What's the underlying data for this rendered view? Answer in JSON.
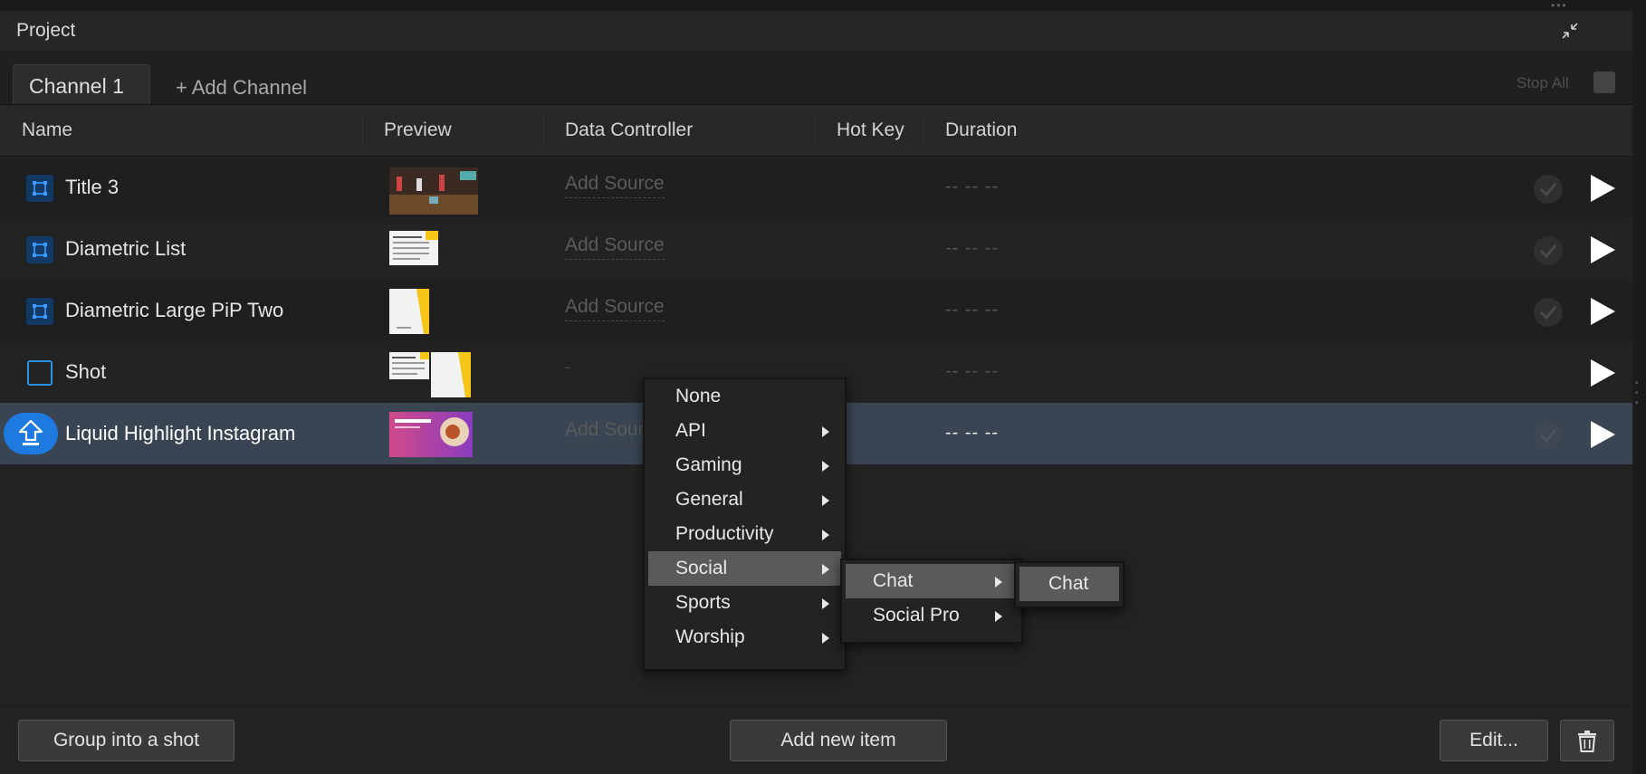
{
  "panel": {
    "title": "Project"
  },
  "tabs": {
    "active": "Channel 1",
    "add": "+ Add Channel",
    "stop_all": "Stop All"
  },
  "columns": {
    "name": "Name",
    "preview": "Preview",
    "data_controller": "Data Controller",
    "hot_key": "Hot Key",
    "duration": "Duration"
  },
  "rows": [
    {
      "name": "Title 3",
      "source": "Add Source",
      "duration": "-- -- --",
      "type": "graphic"
    },
    {
      "name": "Diametric List",
      "source": "Add Source",
      "duration": "-- -- --",
      "type": "graphic"
    },
    {
      "name": "Diametric Large PiP Two",
      "source": "Add Source",
      "duration": "-- -- --",
      "type": "graphic"
    },
    {
      "name": "Shot",
      "source": "-",
      "duration": "-- -- --",
      "type": "shot"
    },
    {
      "name": "Liquid Highlight Instagram",
      "source": "Add Source",
      "duration": "-- -- --",
      "type": "uploading"
    }
  ],
  "menu": {
    "items": [
      "None",
      "API",
      "Gaming",
      "General",
      "Productivity",
      "Social",
      "Sports",
      "Worship"
    ],
    "highlighted": "Social",
    "submenu": [
      "Chat",
      "Social Pro"
    ],
    "submenu_highlighted": "Chat",
    "subsubmenu": [
      "Chat"
    ]
  },
  "footer": {
    "group": "Group into a shot",
    "add_item": "Add new item",
    "edit": "Edit..."
  },
  "colors": {
    "accent_blue": "#1f7ae0",
    "selected_row": "#3a4553",
    "menu_highlight": "#5a5a5a"
  }
}
